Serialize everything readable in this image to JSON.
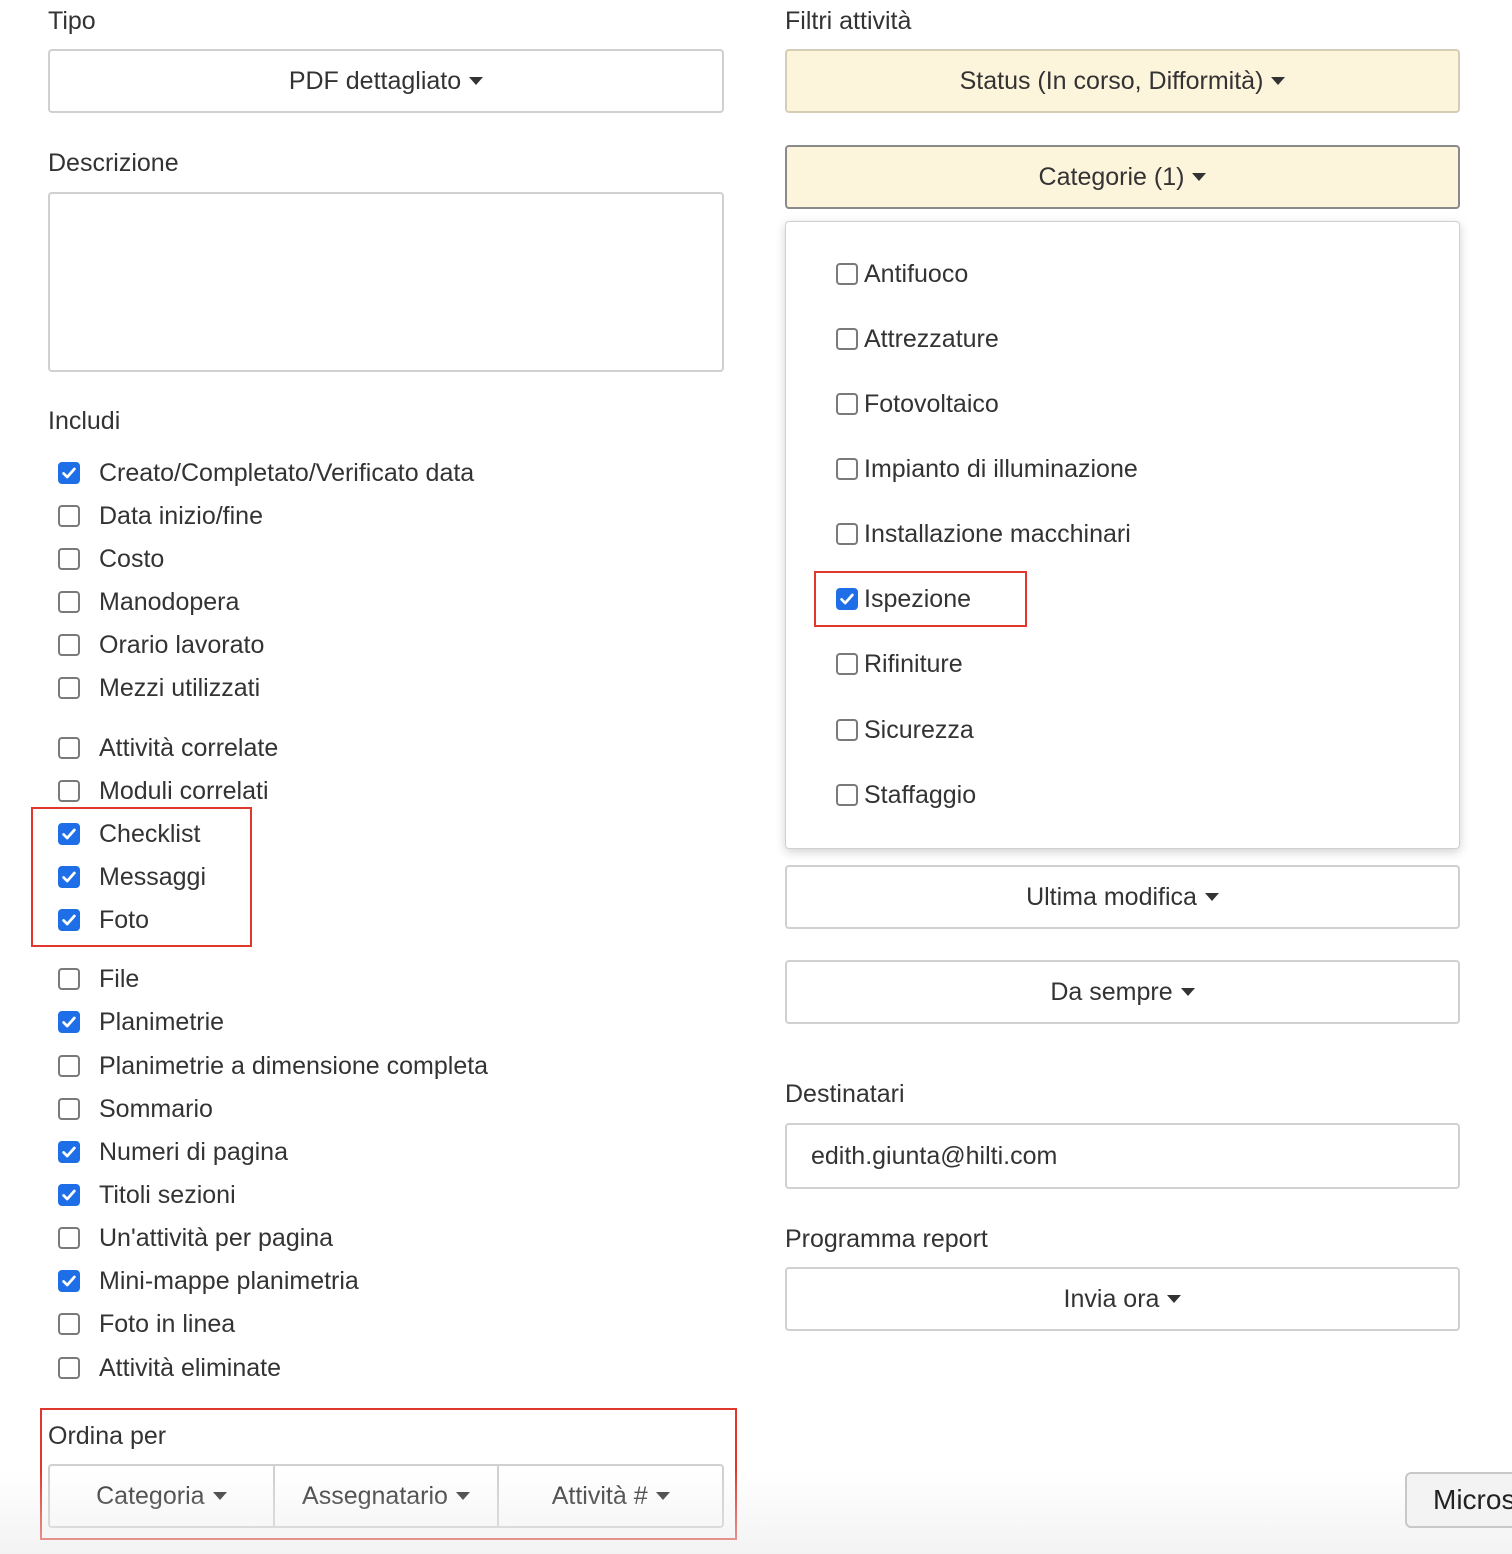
{
  "tipo": {
    "label": "Tipo",
    "value": "PDF dettagliato"
  },
  "descrizione": {
    "label": "Descrizione",
    "value": ""
  },
  "includi": {
    "label": "Includi",
    "items": [
      {
        "label": "Creato/Completato/Verificato data",
        "checked": true
      },
      {
        "label": "Data inizio/fine",
        "checked": false
      },
      {
        "label": "Costo",
        "checked": false
      },
      {
        "label": "Manodopera",
        "checked": false
      },
      {
        "label": "Orario lavorato",
        "checked": false
      },
      {
        "label": "Mezzi utilizzati",
        "checked": false
      },
      {
        "label": "Attività correlate",
        "checked": false
      },
      {
        "label": "Moduli correlati",
        "checked": false
      },
      {
        "label": "Checklist",
        "checked": true
      },
      {
        "label": "Messaggi",
        "checked": true
      },
      {
        "label": "Foto",
        "checked": true
      },
      {
        "label": "File",
        "checked": false
      },
      {
        "label": "Planimetrie",
        "checked": true
      },
      {
        "label": "Planimetrie a dimensione completa",
        "checked": false
      },
      {
        "label": "Sommario",
        "checked": false
      },
      {
        "label": "Numeri di pagina",
        "checked": true
      },
      {
        "label": "Titoli sezioni",
        "checked": true
      },
      {
        "label": "Un'attività per pagina",
        "checked": false
      },
      {
        "label": "Mini-mappe planimetria",
        "checked": true
      },
      {
        "label": "Foto in linea",
        "checked": false
      },
      {
        "label": "Attività eliminate",
        "checked": false
      }
    ]
  },
  "ordina": {
    "label": "Ordina per",
    "buttons": [
      "Categoria",
      "Assegnatario",
      "Attività #"
    ]
  },
  "filtri": {
    "label": "Filtri attività",
    "status": "Status (In corso, Difformità)",
    "categorie": "Categorie (1)",
    "categorie_options": [
      {
        "label": "Antifuoco",
        "checked": false
      },
      {
        "label": "Attrezzature",
        "checked": false
      },
      {
        "label": "Fotovoltaico",
        "checked": false
      },
      {
        "label": "Impianto di illuminazione",
        "checked": false
      },
      {
        "label": "Installazione macchinari",
        "checked": false
      },
      {
        "label": "Ispezione",
        "checked": true
      },
      {
        "label": "Rifiniture",
        "checked": false
      },
      {
        "label": "Sicurezza",
        "checked": false
      },
      {
        "label": "Staffaggio",
        "checked": false
      }
    ],
    "ultima_modifica": "Ultima modifica",
    "periodo": "Da sempre"
  },
  "destinatari": {
    "label": "Destinatari",
    "value": "edith.giunta@hilti.com"
  },
  "programma": {
    "label": "Programma report",
    "value": "Invia ora"
  },
  "taskbar": {
    "label": "Micros"
  },
  "colors": {
    "accent": "#1e6ee8",
    "highlight_bg": "#fdf4dc",
    "annotation_red": "#e0382e"
  }
}
